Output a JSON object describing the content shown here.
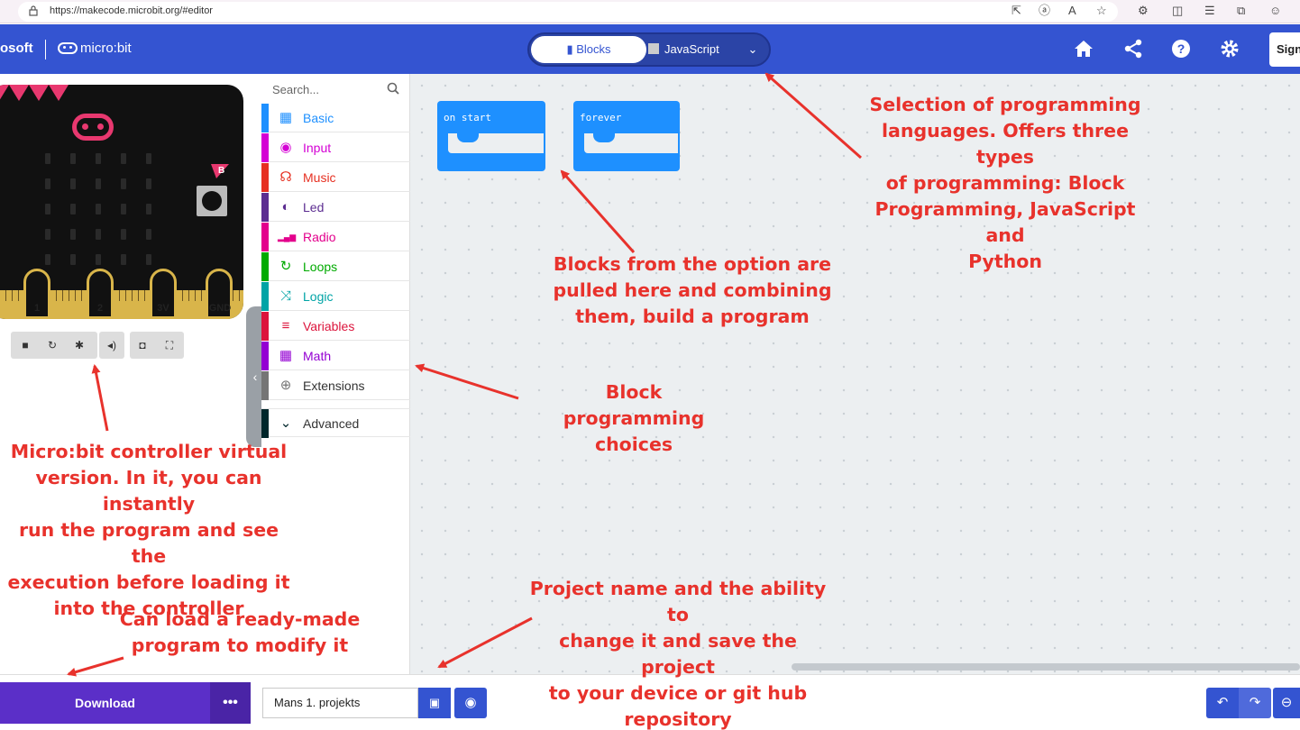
{
  "browser": {
    "url": "https://makecode.microbit.org/#editor",
    "icons": [
      "lock-icon",
      "external-link-icon",
      "read-aloud-icon",
      "text-size-icon",
      "favorite-star-icon",
      "extensions-icon",
      "split-screen-icon",
      "favorites-icon",
      "collections-icon",
      "profile-icon"
    ]
  },
  "header": {
    "brand": "osoft",
    "logo_text": "micro:bit",
    "lang_tabs": {
      "blocks": "Blocks",
      "javascript": "JavaScript"
    },
    "sign_in": "Sign",
    "icons": [
      "home-icon",
      "share-icon",
      "help-icon",
      "settings-icon"
    ]
  },
  "simulator": {
    "pin_labels": [
      "1",
      "2",
      "3V",
      "GND"
    ],
    "button_label": "B",
    "controls": [
      "stop-icon",
      "restart-icon",
      "debug-icon",
      "mute-icon",
      "screenshot-icon",
      "fullscreen-icon"
    ]
  },
  "toolbox": {
    "search_placeholder": "Search...",
    "categories": [
      {
        "label": "Basic",
        "color": "#1e90ff",
        "icon": "grid-icon"
      },
      {
        "label": "Input",
        "color": "#d400d4",
        "icon": "input-icon"
      },
      {
        "label": "Music",
        "color": "#e63022",
        "icon": "headphones-icon"
      },
      {
        "label": "Led",
        "color": "#5c2d91",
        "icon": "toggle-icon"
      },
      {
        "label": "Radio",
        "color": "#e3008c",
        "icon": "signal-icon"
      },
      {
        "label": "Loops",
        "color": "#00aa00",
        "icon": "loop-icon"
      },
      {
        "label": "Logic",
        "color": "#00a4a6",
        "icon": "shuffle-icon"
      },
      {
        "label": "Variables",
        "color": "#dc143c",
        "icon": "list-icon"
      },
      {
        "label": "Math",
        "color": "#9400d3",
        "icon": "calculator-icon"
      },
      {
        "label": "Extensions",
        "color": "#757575",
        "icon": "plus-circle-icon"
      },
      {
        "label": "Advanced",
        "color": "#00272b",
        "icon": "chevron-down-icon"
      }
    ]
  },
  "workspace": {
    "blocks": [
      {
        "label": "on start",
        "color": "#1e90ff"
      },
      {
        "label": "forever",
        "color": "#1e90ff"
      }
    ]
  },
  "bottom": {
    "download": "Download",
    "more": "•••",
    "project_name": "Mans 1. projekts"
  },
  "annotations": {
    "languages": [
      "Selection of programming",
      "languages. Offers three types",
      "of programming: Block",
      "Programming, JavaScript and",
      "Python"
    ],
    "blocks": [
      "Blocks from the option are",
      "pulled here and combining",
      "them, build a program"
    ],
    "choices": [
      "Block programming",
      "choices"
    ],
    "simulator": [
      "Micro:bit controller virtual",
      "version. In it, you can instantly",
      "run the program and see the",
      "execution before loading it",
      "into the controller"
    ],
    "project": [
      "Project name and the ability to",
      "change it and save the project",
      "to your device or git hub",
      "repository"
    ],
    "load": [
      "Can load a ready-made",
      "program to modify it"
    ]
  },
  "colors": {
    "header": "#3454d1",
    "download": "#5b2fc8",
    "annotation": "#e8322c"
  }
}
